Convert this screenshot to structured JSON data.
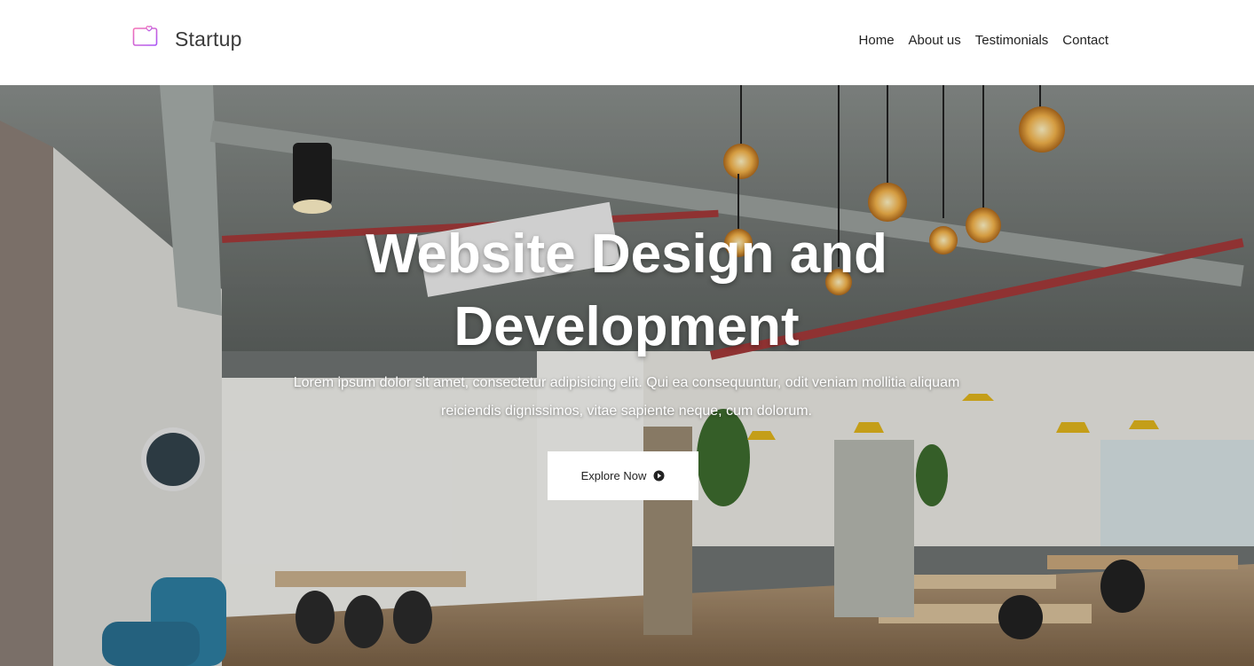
{
  "brand": {
    "name": "Startup",
    "icon": "monitor-heart-icon",
    "icon_gradient": [
      "#f472b6",
      "#a855f7"
    ]
  },
  "nav": {
    "items": [
      {
        "label": "Home"
      },
      {
        "label": "About us"
      },
      {
        "label": "Testimonials"
      },
      {
        "label": "Contact"
      }
    ]
  },
  "hero": {
    "title": "Website Design and Development",
    "description": "Lorem ipsum dolor sit amet, consectetur adipisicing elit. Qui ea consequuntur, odit veniam mollitia aliquam reiciendis dignissimos, vitae sapiente neque, cum dolorum.",
    "button_label": "Explore Now",
    "button_icon": "arrow-right-circle-icon",
    "background_image": "office-interior-photo"
  },
  "colors": {
    "header_bg": "#ffffff",
    "nav_text": "#222222",
    "hero_text": "#ffffff",
    "button_bg": "#ffffff"
  }
}
